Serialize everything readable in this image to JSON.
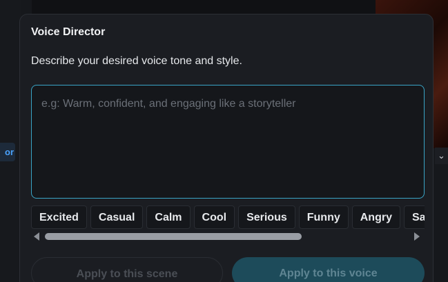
{
  "background": {
    "left_tag_text": "or",
    "chevron_icon": "chevron-down-icon"
  },
  "panel": {
    "title": "Voice Director",
    "description": "Describe your desired voice tone and style.",
    "prompt": {
      "value": "",
      "placeholder": "e.g: Warm, confident, and engaging like a storyteller"
    },
    "tones": [
      "Excited",
      "Casual",
      "Calm",
      "Cool",
      "Serious",
      "Funny",
      "Angry",
      "Sa"
    ],
    "scrollbar_position": 0.0,
    "apply_scene_label": "Apply to this scene",
    "apply_voice_label": "Apply to this voice"
  },
  "colors": {
    "accent_border": "#3aa6c8",
    "primary_button": "#1d4b5a",
    "tag_text": "#4aa3ff"
  }
}
